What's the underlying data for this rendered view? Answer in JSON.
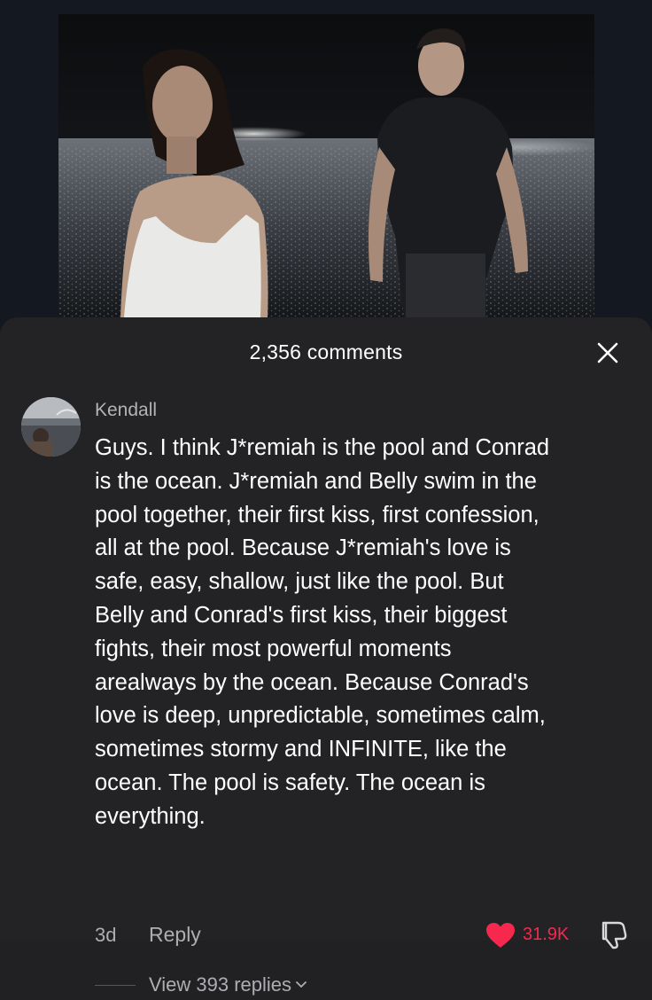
{
  "video": {
    "icon": "video-still-icon"
  },
  "sheet": {
    "title": "2,356 comments",
    "close_icon": "close-icon"
  },
  "comment": {
    "username": "Kendall",
    "text": "Guys. I think J*remiah is the pool and Conrad\nis the ocean. J*remiah and Belly swim in the\npool together, their first kiss, first confession,\nall at the pool. Because J*remiah's love is\nsafe, easy, shallow, just like the pool. But\nBelly and Conrad's first kiss, their biggest\nfights, their most powerful moments\narealways by the ocean. Because Conrad's\nlove is deep, unpredictable, sometimes calm,\nsometimes stormy and INFINITE, like the\nocean. The pool is safety. The ocean is\neverything.",
    "time": "3d",
    "reply_label": "Reply",
    "like_count": "31.9K",
    "liked": true,
    "accent_color": "#f6284d",
    "view_replies_label": "View 393 replies"
  }
}
